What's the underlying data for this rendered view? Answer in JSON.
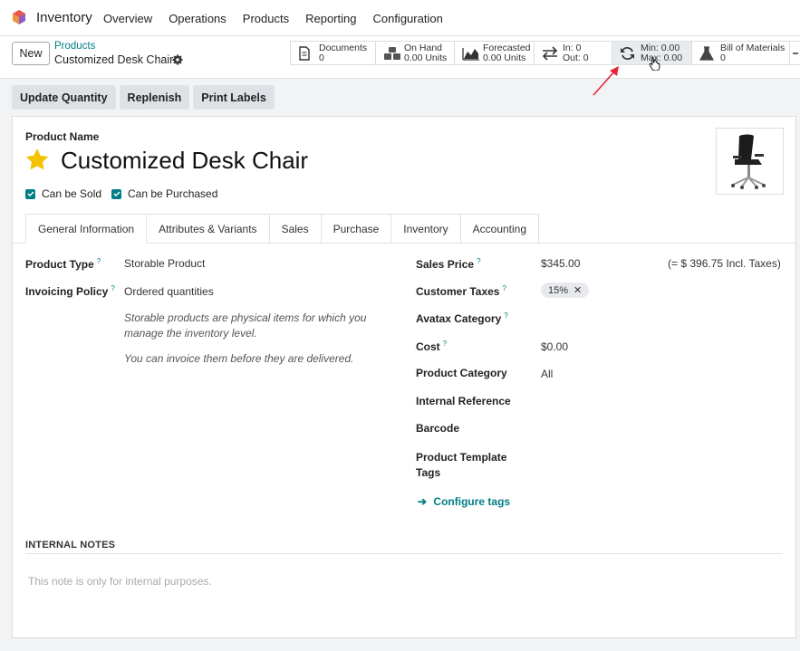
{
  "topbar": {
    "app_name": "Inventory",
    "menu": [
      "Overview",
      "Operations",
      "Products",
      "Reporting",
      "Configuration"
    ]
  },
  "control_panel": {
    "new_label": "New",
    "breadcrumb_parent": "Products",
    "breadcrumb_current": "Customized Desk Chair",
    "stats": [
      {
        "icon": "document-icon",
        "line1": "Documents",
        "line2": "0"
      },
      {
        "icon": "cubes-icon",
        "line1": "On Hand",
        "line2": "0.00 Units"
      },
      {
        "icon": "area-chart-icon",
        "line1": "Forecasted",
        "line2": "0.00 Units"
      },
      {
        "icon": "exchange-icon",
        "line1": "In: 0",
        "line2": "Out: 0"
      },
      {
        "icon": "refresh-icon",
        "line1": "Min: 0.00",
        "line2": "Max: 0.00"
      },
      {
        "icon": "flask-icon",
        "line1": "Bill of Materials",
        "line2": "0"
      }
    ]
  },
  "actions": [
    "Update Quantity",
    "Replenish",
    "Print Labels"
  ],
  "form": {
    "product_name_label": "Product Name",
    "product_name": "Customized Desk Chair",
    "can_be_sold": "Can be Sold",
    "can_be_purchased": "Can be Purchased",
    "tabs": [
      "General Information",
      "Attributes & Variants",
      "Sales",
      "Purchase",
      "Inventory",
      "Accounting"
    ],
    "left": {
      "product_type_label": "Product Type",
      "product_type": "Storable Product",
      "invoicing_policy_label": "Invoicing Policy",
      "invoicing_policy": "Ordered quantities",
      "help1_line1": "Storable products are physical items for which you",
      "help1_line2": "manage the inventory level.",
      "help2": "You can invoice them before they are delivered."
    },
    "right": {
      "sales_price_label": "Sales Price",
      "sales_price": "$345.00",
      "incl_taxes": "(= $ 396.75 Incl. Taxes)",
      "customer_taxes_label": "Customer Taxes",
      "tax_tag": "15%",
      "avatax_label": "Avatax Category",
      "cost_label": "Cost",
      "cost": "$0.00",
      "category_label": "Product Category",
      "category": "All",
      "internal_ref_label": "Internal Reference",
      "barcode_label": "Barcode",
      "template_tags_line1": "Product Template",
      "template_tags_line2": "Tags",
      "configure_tags": "Configure tags"
    },
    "internal_notes_label": "INTERNAL NOTES",
    "internal_notes_placeholder": "This note is only for internal purposes."
  },
  "colors": {
    "accent": "#017e84",
    "star": "#f3c200",
    "annotation_arrow": "#e8233a"
  }
}
